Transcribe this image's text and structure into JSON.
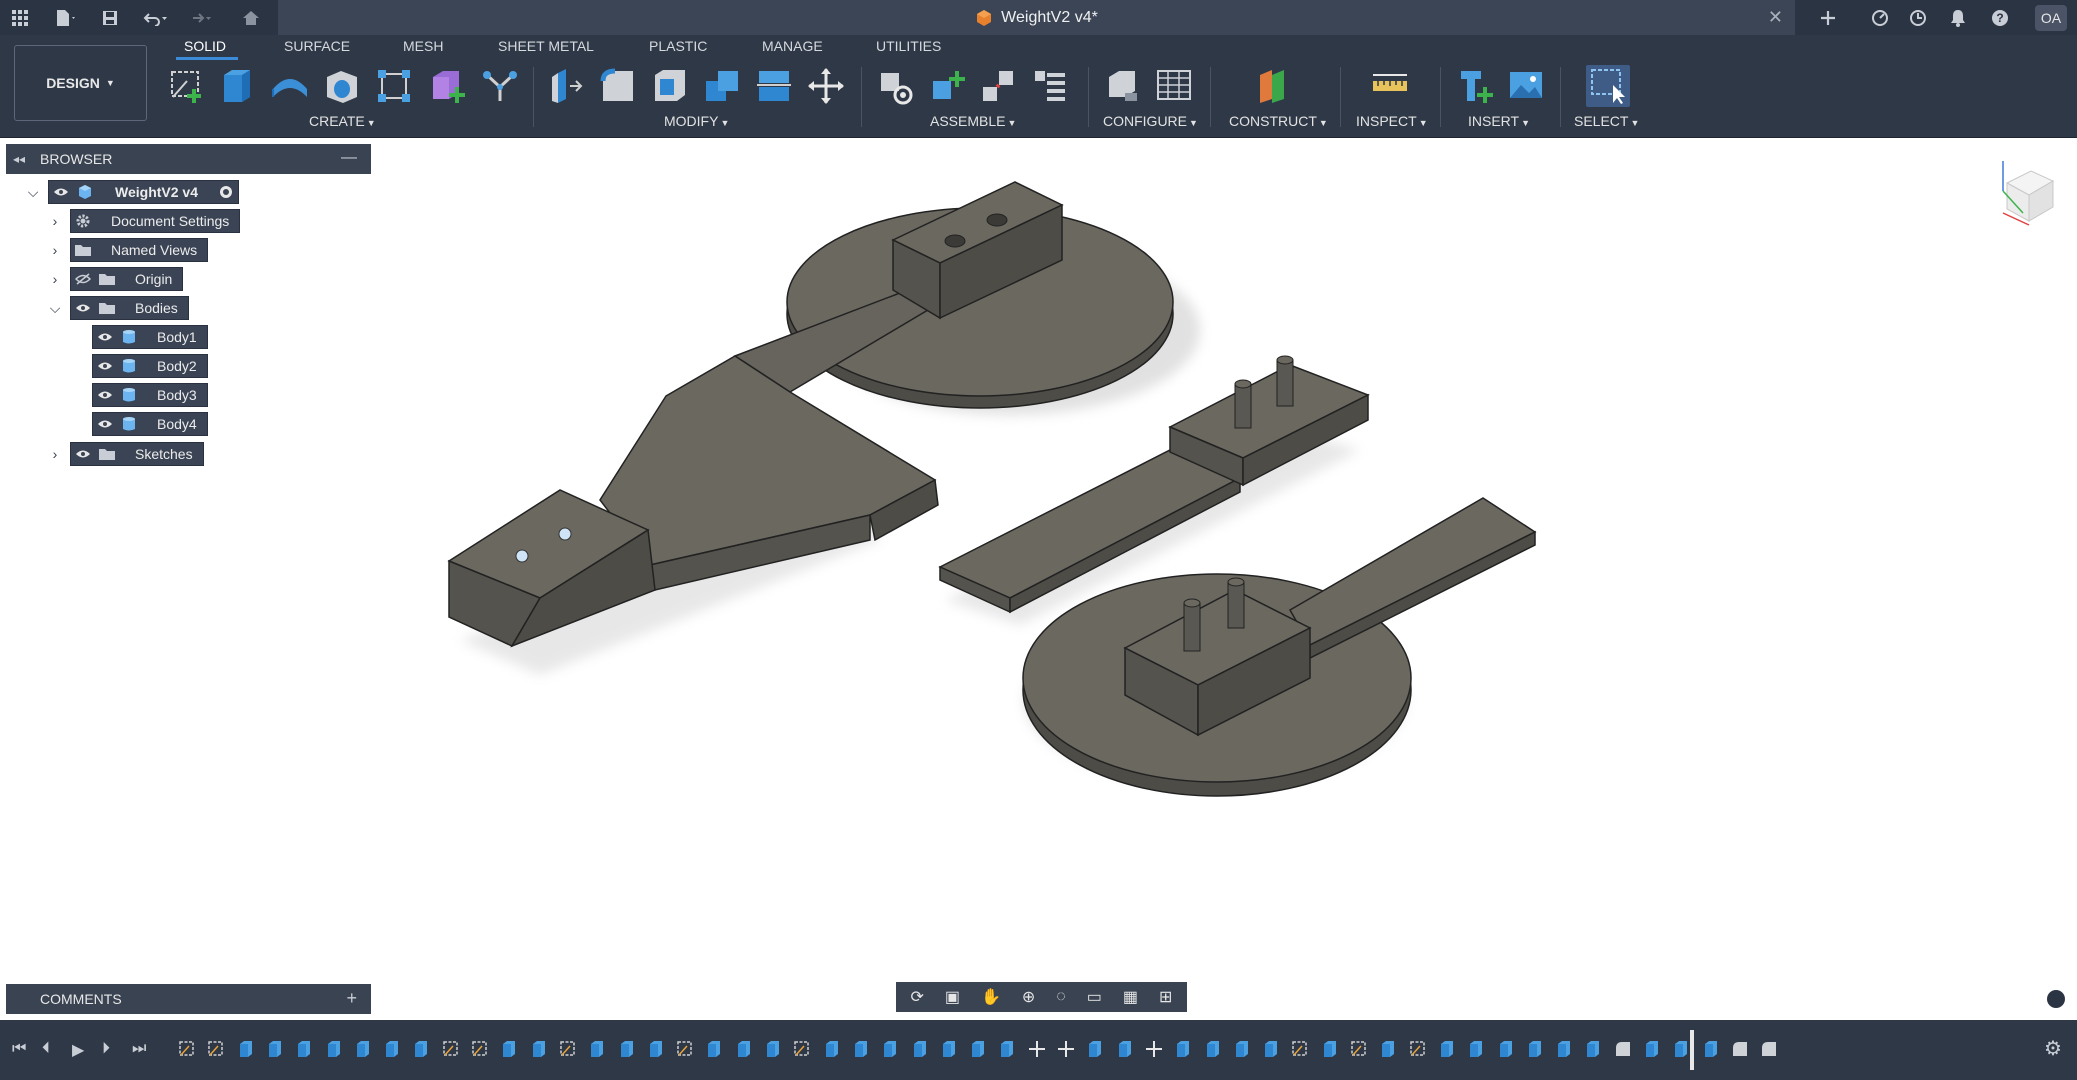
{
  "title_bar": {
    "document_title": "WeightV2 v4*",
    "avatar_initials": "OA"
  },
  "ribbon": {
    "workspace_label": "DESIGN",
    "tabs": [
      {
        "label": "SOLID",
        "active": true
      },
      {
        "label": "SURFACE"
      },
      {
        "label": "MESH"
      },
      {
        "label": "SHEET METAL"
      },
      {
        "label": "PLASTIC"
      },
      {
        "label": "MANAGE"
      },
      {
        "label": "UTILITIES"
      }
    ],
    "groups": {
      "create": "CREATE",
      "modify": "MODIFY",
      "assemble": "ASSEMBLE",
      "configure": "CONFIGURE",
      "construct": "CONSTRUCT",
      "inspect": "INSPECT",
      "insert": "INSERT",
      "select": "SELECT"
    }
  },
  "browser": {
    "header": "BROWSER",
    "root": "WeightV2 v4",
    "items": [
      {
        "label": "Document Settings",
        "icon": "gear-icon"
      },
      {
        "label": "Named Views",
        "icon": "folder-icon"
      },
      {
        "label": "Origin",
        "icon": "folder-icon"
      },
      {
        "label": "Bodies",
        "icon": "folder-icon"
      },
      {
        "label": "Body1",
        "icon": "body-icon"
      },
      {
        "label": "Body2",
        "icon": "body-icon"
      },
      {
        "label": "Body3",
        "icon": "body-icon"
      },
      {
        "label": "Body4",
        "icon": "body-icon"
      },
      {
        "label": "Sketches",
        "icon": "folder-icon"
      }
    ]
  },
  "comments": {
    "label": "COMMENTS"
  },
  "colors": {
    "chrome_dark": "#2b3443",
    "chrome": "#2f3847",
    "panel": "#3a4352",
    "accent": "#3c8bd9",
    "body_face": "#6b6860",
    "body_side": "#55534d"
  }
}
